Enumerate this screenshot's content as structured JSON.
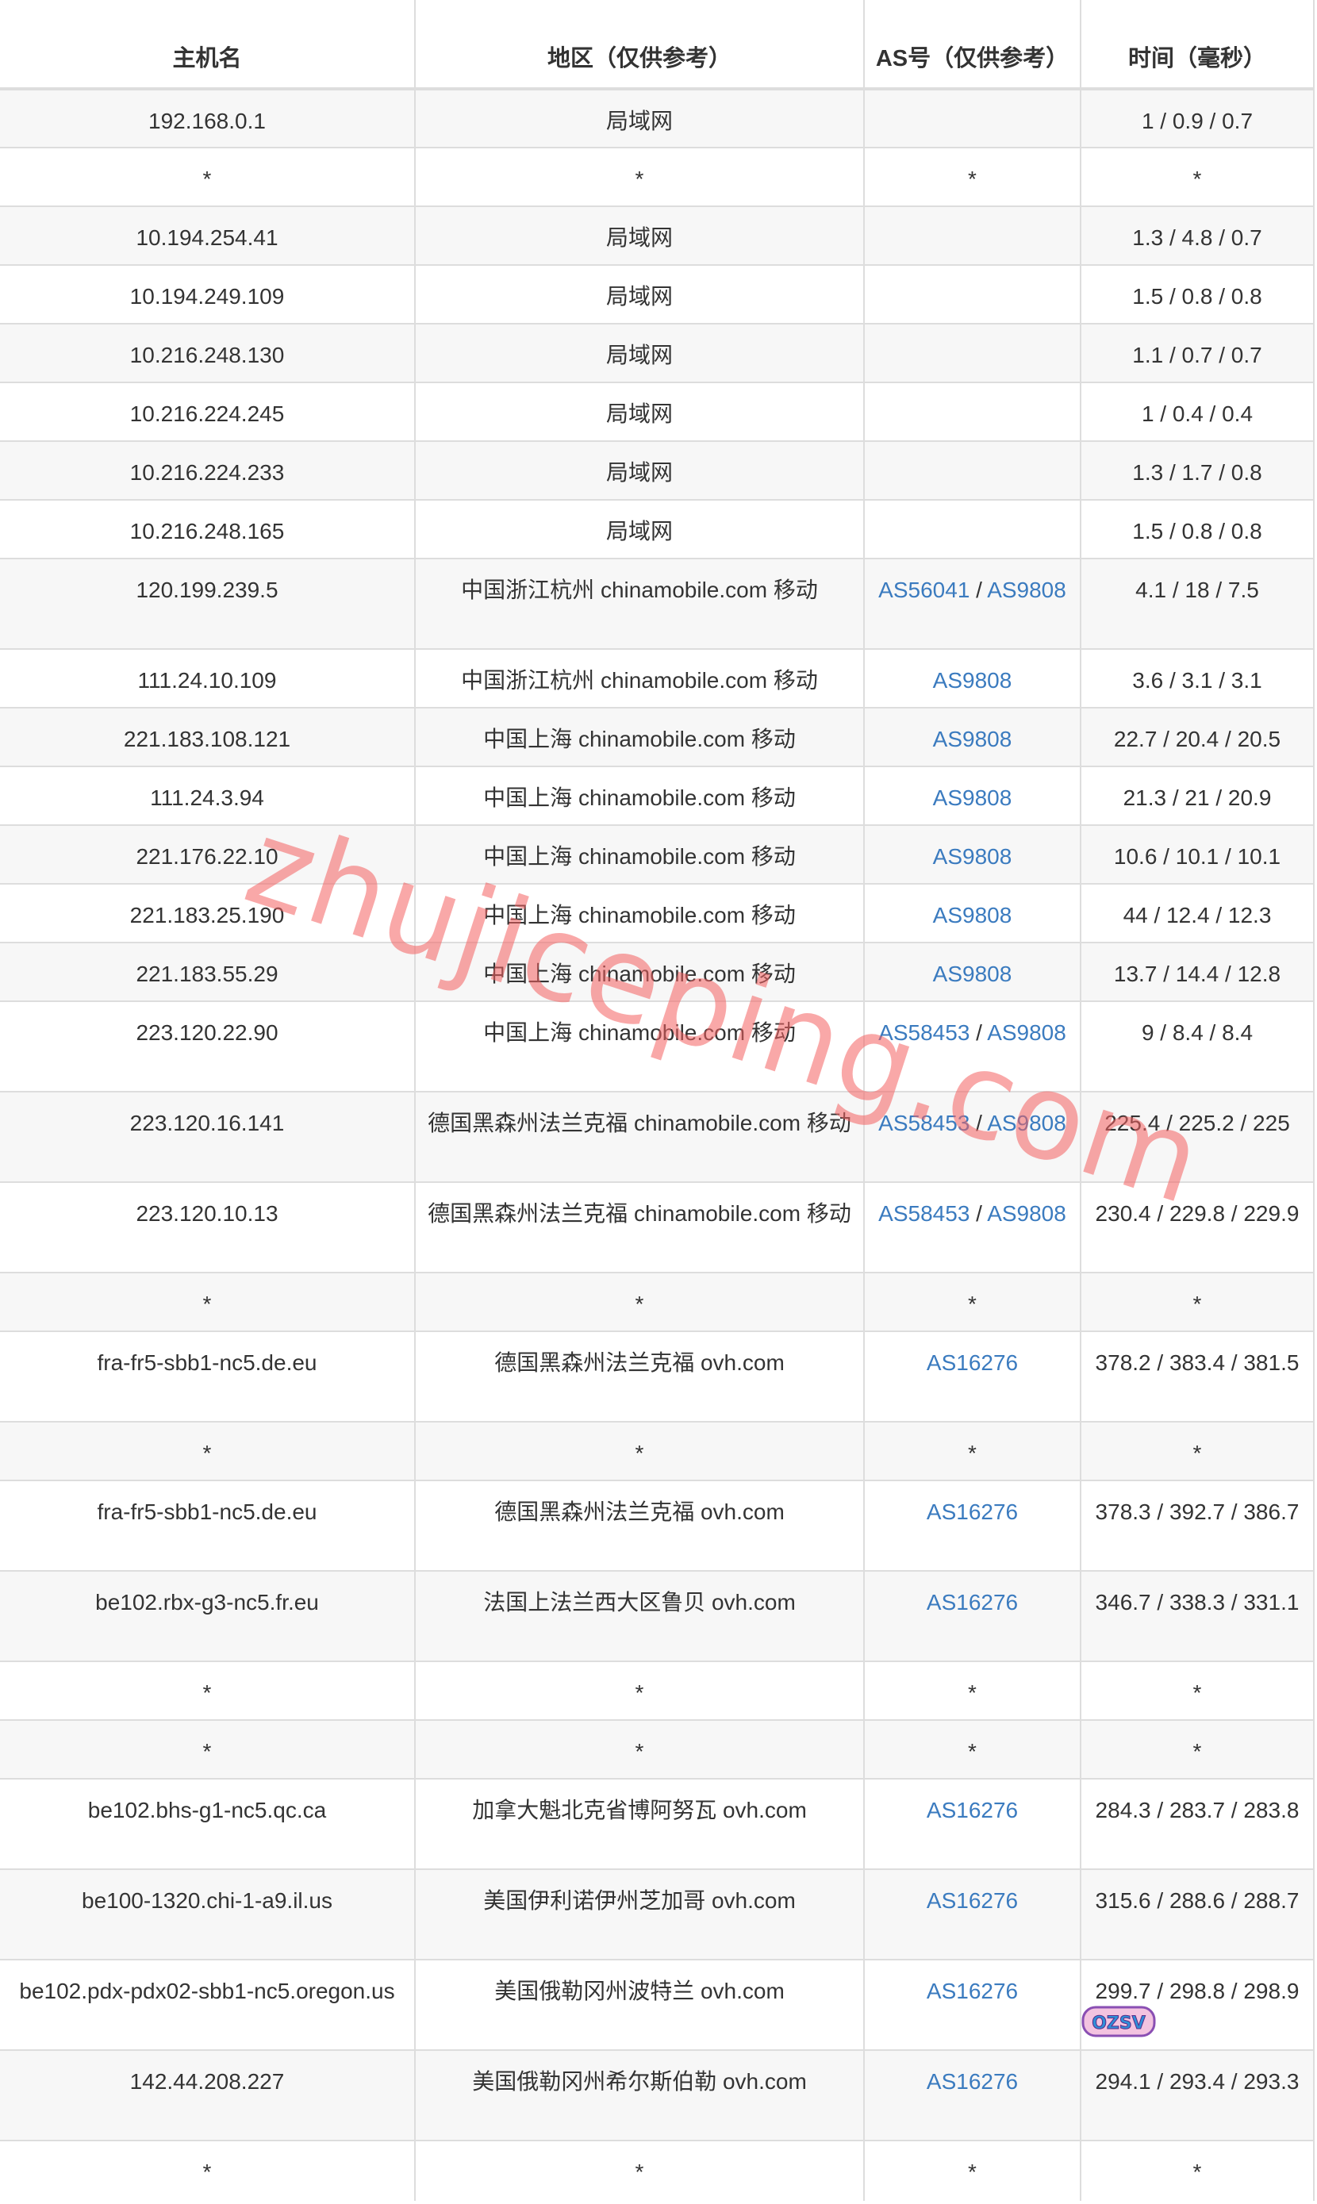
{
  "table": {
    "headers": [
      "主机名",
      "地区（仅供参考）",
      "AS号（仅供参考）",
      "时间（毫秒）"
    ],
    "rows": [
      {
        "host": "192.168.0.1",
        "region": "局域网",
        "as": [],
        "time": "1 / 0.9 / 0.7"
      },
      {
        "host": "*",
        "region": "*",
        "as": [
          "*"
        ],
        "time": "*"
      },
      {
        "host": "10.194.254.41",
        "region": "局域网",
        "as": [],
        "time": "1.3 / 4.8 / 0.7"
      },
      {
        "host": "10.194.249.109",
        "region": "局域网",
        "as": [],
        "time": "1.5 / 0.8 / 0.8"
      },
      {
        "host": "10.216.248.130",
        "region": "局域网",
        "as": [],
        "time": "1.1 / 0.7 / 0.7"
      },
      {
        "host": "10.216.224.245",
        "region": "局域网",
        "as": [],
        "time": "1 / 0.4 / 0.4"
      },
      {
        "host": "10.216.224.233",
        "region": "局域网",
        "as": [],
        "time": "1.3 / 1.7 / 0.8"
      },
      {
        "host": "10.216.248.165",
        "region": "局域网",
        "as": [],
        "time": "1.5 / 0.8 / 0.8"
      },
      {
        "host": "120.199.239.5",
        "region": "中国浙江杭州 chinamobile.com 移动",
        "as": [
          "AS56041",
          "AS9808"
        ],
        "time": "4.1 / 18 / 7.5"
      },
      {
        "host": "111.24.10.109",
        "region": "中国浙江杭州 chinamobile.com 移动",
        "as": [
          "AS9808"
        ],
        "time": "3.6 / 3.1 / 3.1"
      },
      {
        "host": "221.183.108.121",
        "region": "中国上海 chinamobile.com 移动",
        "as": [
          "AS9808"
        ],
        "time": "22.7 / 20.4 / 20.5"
      },
      {
        "host": "111.24.3.94",
        "region": "中国上海 chinamobile.com 移动",
        "as": [
          "AS9808"
        ],
        "time": "21.3 / 21 / 20.9"
      },
      {
        "host": "221.176.22.10",
        "region": "中国上海 chinamobile.com 移动",
        "as": [
          "AS9808"
        ],
        "time": "10.6 / 10.1 / 10.1"
      },
      {
        "host": "221.183.25.190",
        "region": "中国上海 chinamobile.com 移动",
        "as": [
          "AS9808"
        ],
        "time": "44 / 12.4 / 12.3"
      },
      {
        "host": "221.183.55.29",
        "region": "中国上海 chinamobile.com 移动",
        "as": [
          "AS9808"
        ],
        "time": "13.7 / 14.4 / 12.8"
      },
      {
        "host": "223.120.22.90",
        "region": "中国上海 chinamobile.com 移动",
        "as": [
          "AS58453",
          "AS9808"
        ],
        "time": "9 / 8.4 / 8.4"
      },
      {
        "host": "223.120.16.141",
        "region": "德国黑森州法兰克福 chinamobile.com 移动",
        "as": [
          "AS58453",
          "AS9808"
        ],
        "time": "225.4 / 225.2 / 225"
      },
      {
        "host": "223.120.10.13",
        "region": "德国黑森州法兰克福 chinamobile.com 移动",
        "as": [
          "AS58453",
          "AS9808"
        ],
        "time": "230.4 / 229.8 / 229.9"
      },
      {
        "host": "*",
        "region": "*",
        "as": [
          "*"
        ],
        "time": "*"
      },
      {
        "host": "fra-fr5-sbb1-nc5.de.eu",
        "region": "德国黑森州法兰克福 ovh.com",
        "as": [
          "AS16276"
        ],
        "time": "378.2 / 383.4 / 381.5"
      },
      {
        "host": "*",
        "region": "*",
        "as": [
          "*"
        ],
        "time": "*"
      },
      {
        "host": "fra-fr5-sbb1-nc5.de.eu",
        "region": "德国黑森州法兰克福 ovh.com",
        "as": [
          "AS16276"
        ],
        "time": "378.3 / 392.7 / 386.7"
      },
      {
        "host": "be102.rbx-g3-nc5.fr.eu",
        "region": "法国上法兰西大区鲁贝 ovh.com",
        "as": [
          "AS16276"
        ],
        "time": "346.7 / 338.3 / 331.1"
      },
      {
        "host": "*",
        "region": "*",
        "as": [
          "*"
        ],
        "time": "*"
      },
      {
        "host": "*",
        "region": "*",
        "as": [
          "*"
        ],
        "time": "*"
      },
      {
        "host": "be102.bhs-g1-nc5.qc.ca",
        "region": "加拿大魁北克省博阿努瓦 ovh.com",
        "as": [
          "AS16276"
        ],
        "time": "284.3 / 283.7 / 283.8"
      },
      {
        "host": "be100-1320.chi-1-a9.il.us",
        "region": "美国伊利诺伊州芝加哥 ovh.com",
        "as": [
          "AS16276"
        ],
        "time": "315.6 / 288.6 / 288.7"
      },
      {
        "host": "be102.pdx-pdx02-sbb1-nc5.oregon.us",
        "region": "美国俄勒冈州波特兰 ovh.com",
        "as": [
          "AS16276"
        ],
        "time": "299.7 / 298.8 / 298.9"
      },
      {
        "host": "142.44.208.227",
        "region": "美国俄勒冈州希尔斯伯勒 ovh.com",
        "as": [
          "AS16276"
        ],
        "time": "294.1 / 293.4 / 293.3"
      },
      {
        "host": "*",
        "region": "*",
        "as": [
          "*"
        ],
        "time": "*"
      }
    ]
  },
  "watermark": "zhujiceping.com",
  "logo": "OZSV",
  "colors": {
    "link": "#3b7bbf",
    "row_stripe": "#f7f7f7",
    "border": "#dddddd",
    "watermark": "#f46060"
  }
}
